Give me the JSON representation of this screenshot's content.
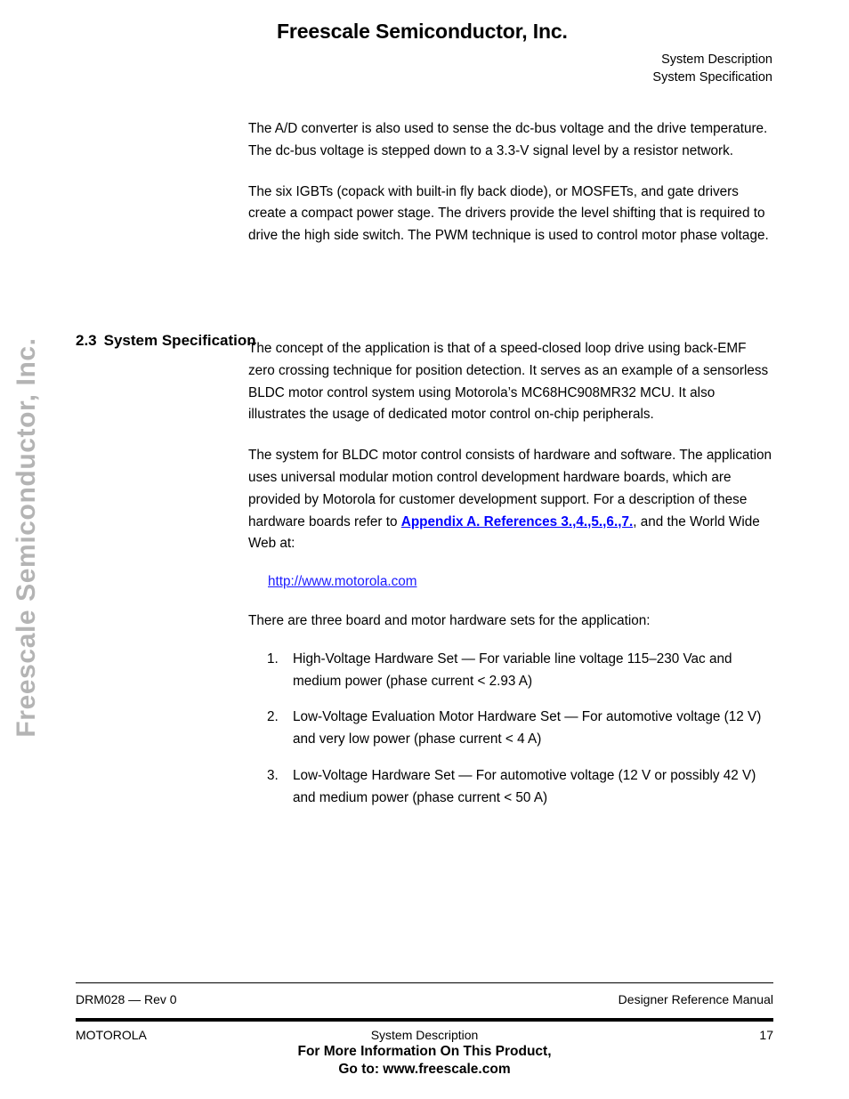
{
  "watermark": {
    "text": "Freescale Semiconductor, Inc.",
    "color": "#b4b4b4"
  },
  "header": {
    "brand_title": "Freescale Semiconductor, Inc.",
    "chapter": "System Description",
    "section": "System Specification"
  },
  "body": {
    "para_1": "The A/D converter is also used to sense the dc-bus voltage and the drive temperature. The dc-bus voltage is stepped down to a 3.3-V signal level by a resistor network.",
    "para_2": "The six IGBTs (copack with built-in fly back diode), or MOSFETs, and gate drivers create a compact power stage. The drivers provide the level shifting that is required to drive the high side switch. The PWM technique is used to control motor phase voltage.",
    "para_3": "The concept of the application is that of a speed-closed loop drive using back-EMF zero crossing technique for position detection. It serves as an example of a sensorless BLDC motor control system using Motorola’s MC68HC908MR32 MCU. It also illustrates the usage of dedicated motor control on-chip peripherals.",
    "para_4_before_link": "The system for BLDC motor control consists of hardware and software. The application uses universal modular motion control development hardware boards, which are provided by Motorola for customer development support. For a description of these hardware boards refer to ",
    "para_4_link": "Appendix A. References 3.,4.,5.,6.,7.",
    "para_4_after_link": ", and the World Wide Web at:",
    "url": "http://www.motorola.com",
    "para_5": "There are three board and motor hardware sets for the application:"
  },
  "section_heading": {
    "number": "2.3",
    "title": "System Specification"
  },
  "hardware_list": [
    {
      "num": "1.",
      "text": "High-Voltage Hardware Set — For variable line voltage 115–230 Vac and medium power (phase current < 2.93 A)"
    },
    {
      "num": "2.",
      "text": "Low-Voltage Evaluation Motor Hardware Set — For automotive voltage (12 V) and very low power (phase current < 4 A)"
    },
    {
      "num": "3.",
      "text": "Low-Voltage Hardware Set — For automotive voltage (12 V or possibly 42 V) and medium power (phase current < 50 A)"
    }
  ],
  "footer": {
    "doc_rev": "DRM028 — Rev 0",
    "manual_type": "Designer Reference Manual",
    "company": "MOTOROLA",
    "chapter": "System Description",
    "page_number": "17",
    "promo_line1": "For More Information On This Product,",
    "promo_line2": "Go to: www.freescale.com"
  },
  "colors": {
    "link_blue": "#0000ff",
    "url_blue": "#1a1aff",
    "watermark_gray": "#b4b4b4",
    "text_black": "#000000"
  }
}
